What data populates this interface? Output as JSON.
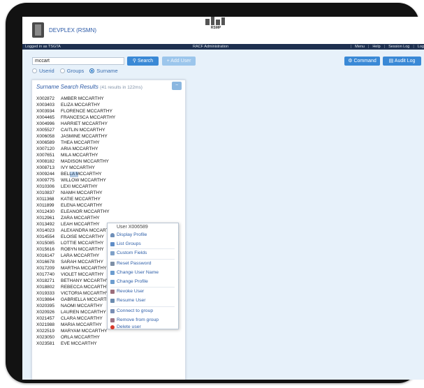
{
  "app": {
    "title": "DEVPLEX (RSMN)",
    "rsmp_label": "RSMP",
    "logged_in": "Logged in as TSGTA",
    "section": "RACF Administration"
  },
  "nav": {
    "menu": "Menu",
    "help": "Help",
    "session_log": "Session Log",
    "logoff": "Logoff"
  },
  "search": {
    "value": "mccart",
    "search_label": "Search",
    "add_user_label": "+ Add User",
    "radio_userid": "Userid",
    "radio_groups": "Groups",
    "radio_surname": "Surname",
    "selected": "Surname"
  },
  "actions": {
    "command_label": "Command",
    "audit_log_label": "Audit Log"
  },
  "results": {
    "title": "Surname Search Results",
    "count_text": "(41 results in 122ms)",
    "rows": [
      {
        "id": "X002872",
        "name": "AMBER MCCARTHY"
      },
      {
        "id": "X003403",
        "name": "ELIZA MCCARTHY"
      },
      {
        "id": "X003934",
        "name": "FLORENCE MCCARTHY"
      },
      {
        "id": "X004465",
        "name": "FRANCESCA MCCARTHY"
      },
      {
        "id": "X004996",
        "name": "HARRIET MCCARTHY"
      },
      {
        "id": "X005527",
        "name": "CAITLIN MCCARTHY"
      },
      {
        "id": "X006058",
        "name": "JASMINE MCCARTHY"
      },
      {
        "id": "X006589",
        "name": "THEA MCCARTHY"
      },
      {
        "id": "X007120",
        "name": "ARIA MCCARTHY"
      },
      {
        "id": "X007651",
        "name": "MILA MCCARTHY"
      },
      {
        "id": "X008182",
        "name": "MADISON MCCARTHY"
      },
      {
        "id": "X008713",
        "name": "IVY MCCARTHY"
      },
      {
        "id": "X009244",
        "name": "BELLA MCCARTHY"
      },
      {
        "id": "X009775",
        "name": "WILLOW MCCARTHY"
      },
      {
        "id": "X010306",
        "name": "LEXI MCCARTHY"
      },
      {
        "id": "X010837",
        "name": "NIAMH MCCARTHY"
      },
      {
        "id": "X011368",
        "name": "KATIE MCCARTHY"
      },
      {
        "id": "X011899",
        "name": "ELENA MCCARTHY"
      },
      {
        "id": "X012430",
        "name": "ELEANOR MCCARTHY"
      },
      {
        "id": "X012961",
        "name": "ZARA MCCARTHY"
      },
      {
        "id": "X013492",
        "name": "LEAH MCCARTHY"
      },
      {
        "id": "X014023",
        "name": "ALEXANDRA MCCARTHY"
      },
      {
        "id": "X014554",
        "name": "ELOISE MCCARTHY"
      },
      {
        "id": "X015085",
        "name": "LOTTIE MCCARTHY"
      },
      {
        "id": "X015616",
        "name": "ROBYN MCCARTHY"
      },
      {
        "id": "X016147",
        "name": "LARA MCCARTHY"
      },
      {
        "id": "X016678",
        "name": "SARAH MCCARTHY"
      },
      {
        "id": "X017209",
        "name": "MARTHA MCCARTHY"
      },
      {
        "id": "X017740",
        "name": "VIOLET MCCARTHY"
      },
      {
        "id": "X018271",
        "name": "BETHANY MCCARTHY"
      },
      {
        "id": "X018802",
        "name": "REBECCA MCCARTHY"
      },
      {
        "id": "X019333",
        "name": "VICTORIA MCCARTHY"
      },
      {
        "id": "X019864",
        "name": "GABRIELLA MCCARTHY"
      },
      {
        "id": "X020395",
        "name": "NAOMI MCCARTHY"
      },
      {
        "id": "X020926",
        "name": "LAUREN MCCARTHY"
      },
      {
        "id": "X021457",
        "name": "CLARA MCCARTHY"
      },
      {
        "id": "X021988",
        "name": "MARIA MCCARTHY"
      },
      {
        "id": "X022519",
        "name": "MARYAM MCCARTHY"
      },
      {
        "id": "X023050",
        "name": "ORLA MCCARTHY"
      },
      {
        "id": "X023581",
        "name": "EVE MCCARTHY"
      }
    ]
  },
  "context_menu": {
    "title": "User X006589",
    "items": [
      {
        "label": "Display Profile",
        "icon": "user-icon"
      },
      {
        "label": "List Groups",
        "icon": "group-icon"
      },
      {
        "label": "Custom Fields",
        "icon": "field-icon"
      },
      {
        "label": "Reset Password",
        "icon": "key-icon"
      },
      {
        "label": "Change User Name",
        "icon": "edit-icon"
      },
      {
        "label": "Change Profile",
        "icon": "edit-icon"
      },
      {
        "label": "Revoke User",
        "icon": "revoke-icon"
      },
      {
        "label": "Resume User",
        "icon": "resume-icon"
      },
      {
        "label": "Connect to group",
        "icon": "connect-icon"
      },
      {
        "label": "Remove from group",
        "icon": "remove-icon"
      },
      {
        "label": "Delete user",
        "icon": "delete-icon"
      }
    ]
  }
}
